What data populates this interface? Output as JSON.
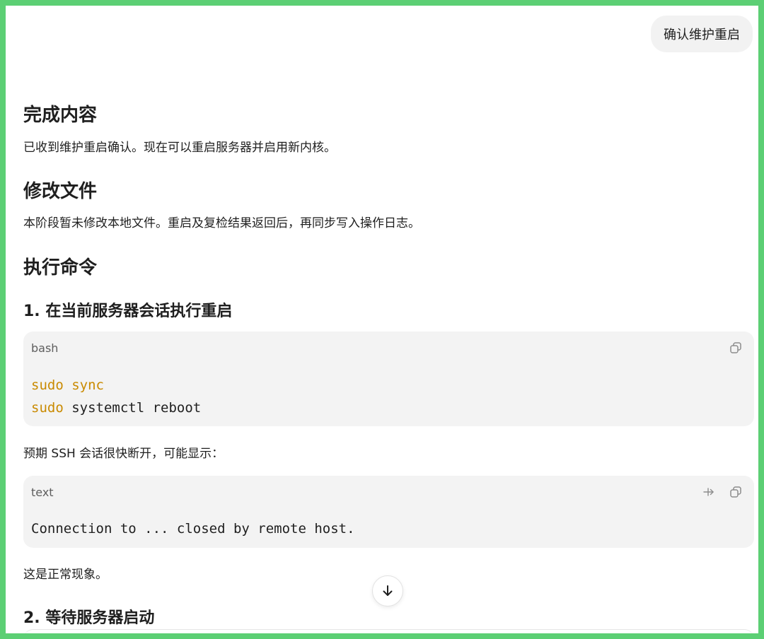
{
  "user_message": "确认维护重启",
  "sections": {
    "done": {
      "heading": "完成内容",
      "text": "已收到维护重启确认。现在可以重启服务器并启用新内核。"
    },
    "files": {
      "heading": "修改文件",
      "text": "本阶段暂未修改本地文件。重启及复检结果返回后，再同步写入操作日志。"
    },
    "commands": {
      "heading": "执行命令",
      "step1": "1. 在当前服务器会话执行重启",
      "code1": {
        "lang": "bash",
        "line1_cmd": "sudo",
        "line1_arg": "sync",
        "line2_cmd": "sudo",
        "line2_arg": " systemctl reboot"
      },
      "expect_text": "预期 SSH 会话很快断开，可能显示：",
      "code2": {
        "lang": "text",
        "line1": "Connection to ... closed by remote host."
      },
      "normal_text": "这是正常现象。",
      "step2": "2. 等待服务器启动"
    }
  },
  "icons": {
    "copy": "copy-icon",
    "wrap": "wrap-icon",
    "scroll": "arrow-down-icon"
  },
  "colors": {
    "frame": "#5ccf74",
    "keyword": "#c98a00",
    "code_bg": "#f3f3f3"
  }
}
